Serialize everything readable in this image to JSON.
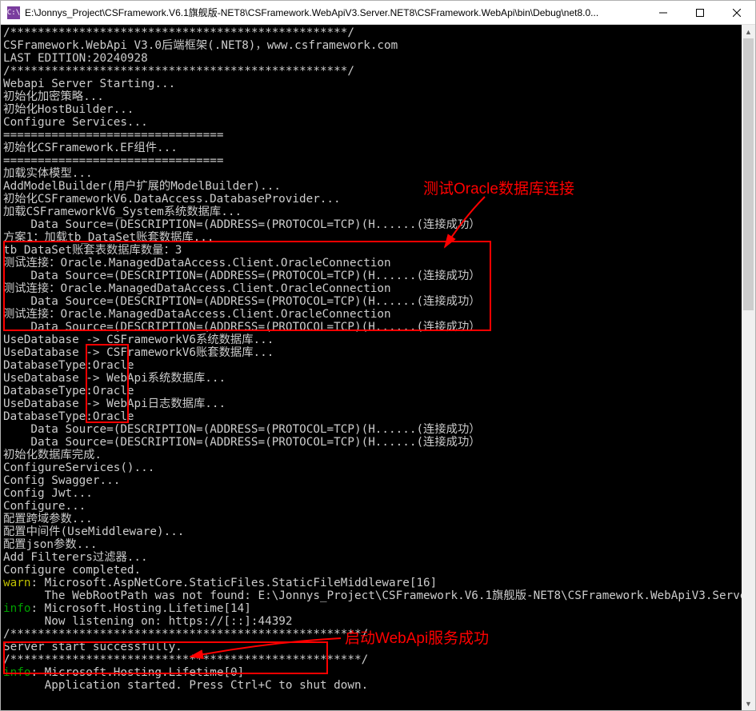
{
  "window": {
    "icon_label": "C:\\",
    "title": "E:\\Jonnys_Project\\CSFramework.V6.1旗舰版-NET8\\CSFramework.WebApiV3.Server.NET8\\CSFramework.WebApi\\bin\\Debug\\net8.0..."
  },
  "console_lines": [
    "/*************************************************/",
    "CSFramework.WebApi V3.0后端框架(.NET8)，www.csframework.com",
    "LAST EDITION:20240928",
    "/*************************************************/",
    "Webapi Server Starting...",
    "初始化加密策略...",
    "初始化HostBuilder...",
    "Configure Services...",
    "================================",
    "初始化CSFramework.EF组件...",
    "================================",
    "加载实体模型...",
    "AddModelBuilder(用户扩展的ModelBuilder)...",
    "初始化CSFrameworkV6.DataAccess.DatabaseProvider...",
    "加载CSFrameworkV6_System系统数据库...",
    "    Data Source=(DESCRIPTION=(ADDRESS=(PROTOCOL=TCP)(H......(连接成功）",
    "方案1：加载tb_DataSet账套数据库...",
    "tb_DataSet账套表数据库数量：3",
    "测试连接：Oracle.ManagedDataAccess.Client.OracleConnection",
    "    Data Source=(DESCRIPTION=(ADDRESS=(PROTOCOL=TCP)(H......(连接成功）",
    "测试连接：Oracle.ManagedDataAccess.Client.OracleConnection",
    "    Data Source=(DESCRIPTION=(ADDRESS=(PROTOCOL=TCP)(H......(连接成功）",
    "测试连接：Oracle.ManagedDataAccess.Client.OracleConnection",
    "    Data Source=(DESCRIPTION=(ADDRESS=(PROTOCOL=TCP)(H......(连接成功）",
    "UseDatabase -> CSFrameworkV6系统数据库...",
    "UseDatabase -> CSFrameworkV6账套数据库...",
    "DatabaseType:Oracle",
    "UseDatabase -> WebApi系统数据库...",
    "DatabaseType:Oracle",
    "UseDatabase -> WebApi日志数据库...",
    "DatabaseType:Oracle",
    "    Data Source=(DESCRIPTION=(ADDRESS=(PROTOCOL=TCP)(H......(连接成功）",
    "    Data Source=(DESCRIPTION=(ADDRESS=(PROTOCOL=TCP)(H......(连接成功）",
    "初始化数据库完成.",
    "ConfigureServices()...",
    "Config Swagger...",
    "Config Jwt...",
    "Configure...",
    "配置跨域参数...",
    "配置中间件(UseMiddleware)...",
    "配置json参数...",
    "Add Filterers过滤器...",
    "Configure completed.",
    {
      "prefix": "warn",
      "prefix_text": "warn",
      "rest": ": Microsoft.AspNetCore.StaticFiles.StaticFileMiddleware[16]"
    },
    "      The WebRootPath was not found: E:\\Jonnys_Project\\CSFramework.V6.1旗舰版-NET8\\CSFramework.WebApiV3.Server.NET8\\CSFramework.WebApi\\wwwroot. Static files may be unavailable.",
    {
      "prefix": "info",
      "prefix_text": "info",
      "rest": ": Microsoft.Hosting.Lifetime[14]"
    },
    "      Now listening on: https://[::]:44392",
    "/***************************************************/",
    "Server start successfully.",
    "/***************************************************/",
    {
      "prefix": "info",
      "prefix_text": "info",
      "rest": ": Microsoft.Hosting.Lifetime[0]"
    },
    "      Application started. Press Ctrl+C to shut down."
  ],
  "annotations": {
    "oracle_test_label": "测试Oracle数据库连接",
    "server_start_label": "启动WebApi服务成功"
  }
}
